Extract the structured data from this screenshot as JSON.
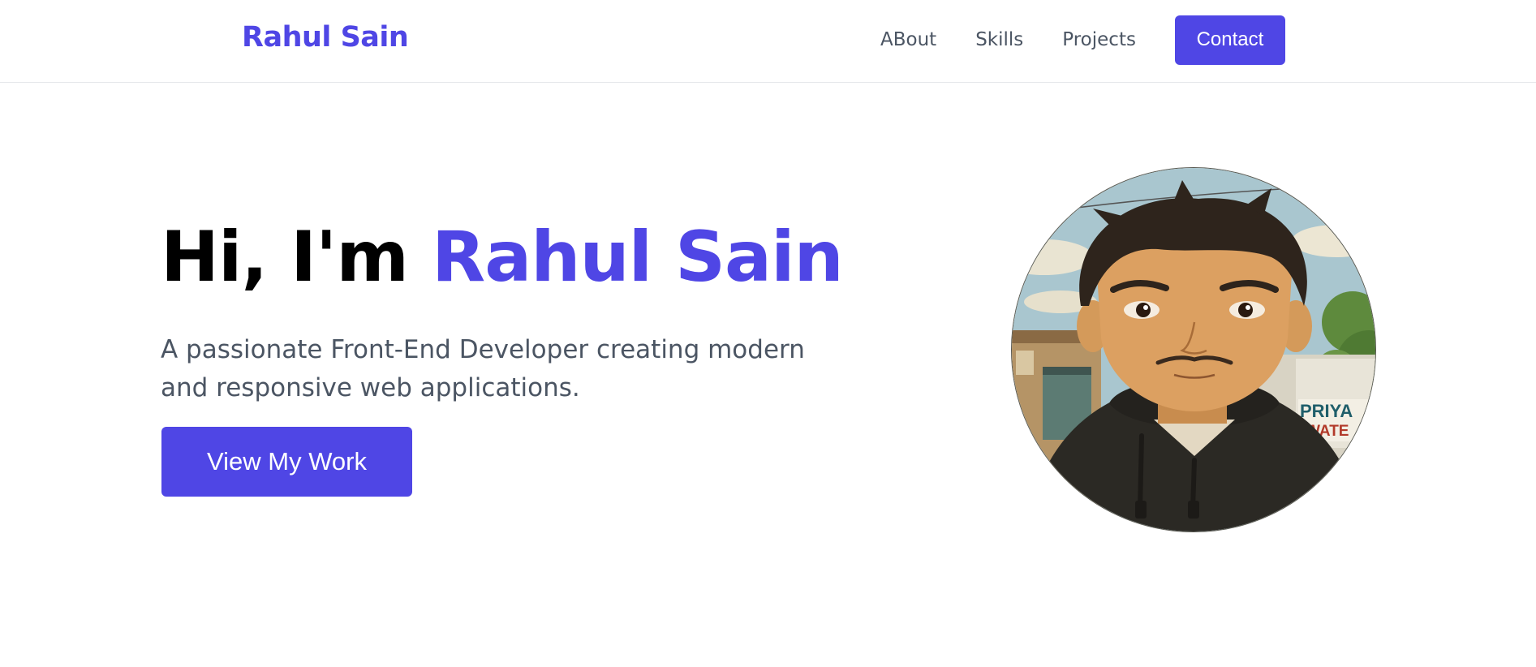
{
  "header": {
    "brand": "Rahul Sain",
    "nav": {
      "about": "ABout",
      "skills": "Skills",
      "projects": "Projects",
      "contact": "Contact"
    }
  },
  "hero": {
    "greeting": "Hi, I'm",
    "name": "Rahul Sain",
    "subtitle": "A passionate Front-End Developer creating modern and responsive web applications.",
    "cta_label": "View My Work",
    "avatar_sign_line1": "PRIYA",
    "avatar_sign_line2": "WATE"
  },
  "colors": {
    "accent": "#4f46e5",
    "text_dark": "#000000",
    "text_muted": "#4b5563",
    "border": "#e5e7eb"
  }
}
